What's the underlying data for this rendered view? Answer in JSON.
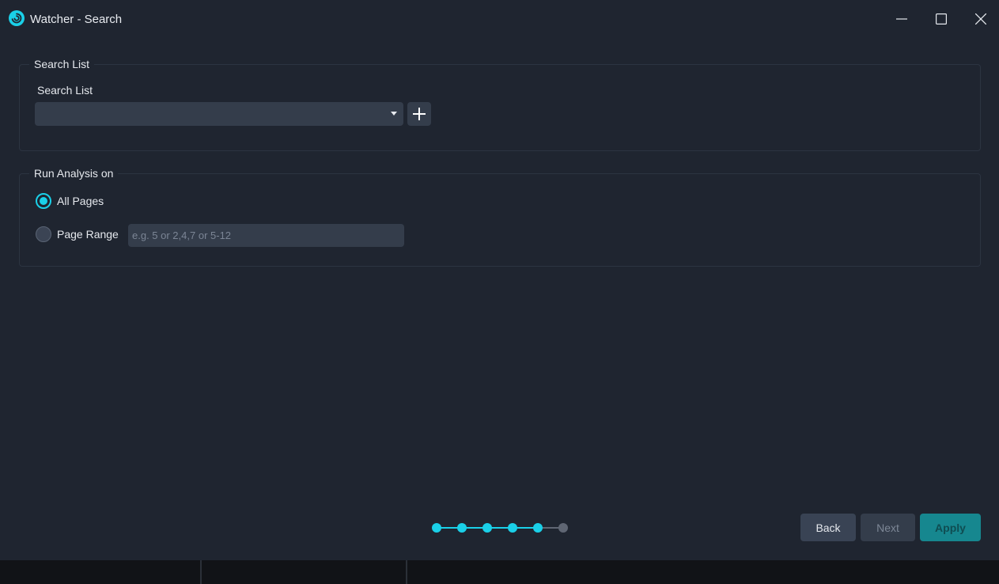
{
  "window": {
    "title": "Watcher - Search",
    "app_icon": "watcher-logo-icon",
    "controls": [
      "minimize-icon",
      "maximize-icon",
      "close-icon"
    ]
  },
  "search_list_group": {
    "legend": "Search List",
    "field_label": "Search List",
    "selected_value": "",
    "add_icon": "plus-icon"
  },
  "run_analysis_group": {
    "legend": "Run Analysis on",
    "options": [
      {
        "label": "All Pages",
        "checked": true
      },
      {
        "label": "Page Range",
        "checked": false
      }
    ],
    "page_range": {
      "value": "",
      "placeholder": "e.g. 5 or 2,4,7 or 5-12"
    }
  },
  "wizard_progress": {
    "total_steps": 6,
    "completed_steps": 5
  },
  "footer": {
    "back_label": "Back",
    "next_label": "Next",
    "apply_label": "Apply"
  },
  "colors": {
    "accent": "#1ad0e8",
    "background": "#1f2530",
    "input_background": "#343d4b",
    "apply_button": "#16878f",
    "inactive_step": "#5f6673"
  }
}
